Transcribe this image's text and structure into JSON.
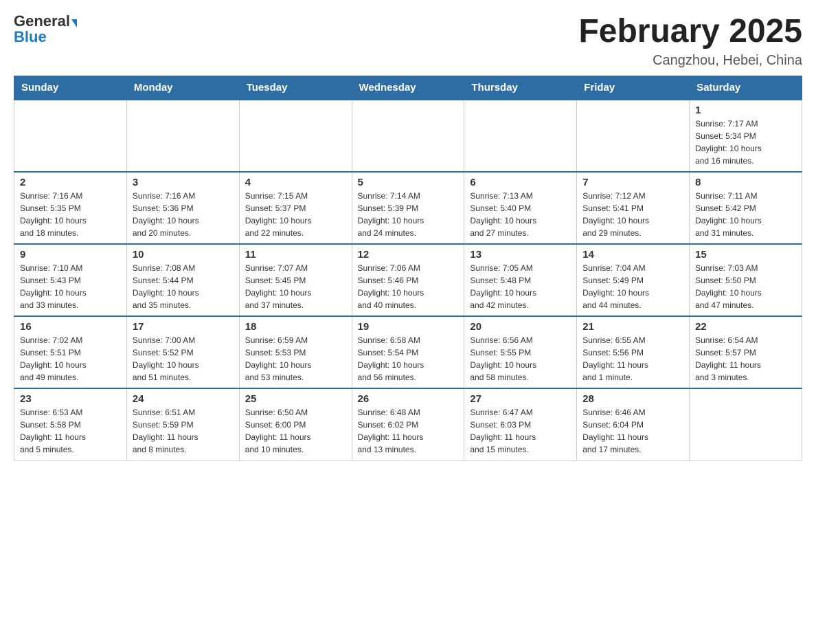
{
  "logo": {
    "general": "General",
    "blue": "Blue"
  },
  "title": "February 2025",
  "subtitle": "Cangzhou, Hebei, China",
  "weekdays": [
    "Sunday",
    "Monday",
    "Tuesday",
    "Wednesday",
    "Thursday",
    "Friday",
    "Saturday"
  ],
  "weeks": [
    [
      {
        "day": "",
        "info": ""
      },
      {
        "day": "",
        "info": ""
      },
      {
        "day": "",
        "info": ""
      },
      {
        "day": "",
        "info": ""
      },
      {
        "day": "",
        "info": ""
      },
      {
        "day": "",
        "info": ""
      },
      {
        "day": "1",
        "info": "Sunrise: 7:17 AM\nSunset: 5:34 PM\nDaylight: 10 hours\nand 16 minutes."
      }
    ],
    [
      {
        "day": "2",
        "info": "Sunrise: 7:16 AM\nSunset: 5:35 PM\nDaylight: 10 hours\nand 18 minutes."
      },
      {
        "day": "3",
        "info": "Sunrise: 7:16 AM\nSunset: 5:36 PM\nDaylight: 10 hours\nand 20 minutes."
      },
      {
        "day": "4",
        "info": "Sunrise: 7:15 AM\nSunset: 5:37 PM\nDaylight: 10 hours\nand 22 minutes."
      },
      {
        "day": "5",
        "info": "Sunrise: 7:14 AM\nSunset: 5:39 PM\nDaylight: 10 hours\nand 24 minutes."
      },
      {
        "day": "6",
        "info": "Sunrise: 7:13 AM\nSunset: 5:40 PM\nDaylight: 10 hours\nand 27 minutes."
      },
      {
        "day": "7",
        "info": "Sunrise: 7:12 AM\nSunset: 5:41 PM\nDaylight: 10 hours\nand 29 minutes."
      },
      {
        "day": "8",
        "info": "Sunrise: 7:11 AM\nSunset: 5:42 PM\nDaylight: 10 hours\nand 31 minutes."
      }
    ],
    [
      {
        "day": "9",
        "info": "Sunrise: 7:10 AM\nSunset: 5:43 PM\nDaylight: 10 hours\nand 33 minutes."
      },
      {
        "day": "10",
        "info": "Sunrise: 7:08 AM\nSunset: 5:44 PM\nDaylight: 10 hours\nand 35 minutes."
      },
      {
        "day": "11",
        "info": "Sunrise: 7:07 AM\nSunset: 5:45 PM\nDaylight: 10 hours\nand 37 minutes."
      },
      {
        "day": "12",
        "info": "Sunrise: 7:06 AM\nSunset: 5:46 PM\nDaylight: 10 hours\nand 40 minutes."
      },
      {
        "day": "13",
        "info": "Sunrise: 7:05 AM\nSunset: 5:48 PM\nDaylight: 10 hours\nand 42 minutes."
      },
      {
        "day": "14",
        "info": "Sunrise: 7:04 AM\nSunset: 5:49 PM\nDaylight: 10 hours\nand 44 minutes."
      },
      {
        "day": "15",
        "info": "Sunrise: 7:03 AM\nSunset: 5:50 PM\nDaylight: 10 hours\nand 47 minutes."
      }
    ],
    [
      {
        "day": "16",
        "info": "Sunrise: 7:02 AM\nSunset: 5:51 PM\nDaylight: 10 hours\nand 49 minutes."
      },
      {
        "day": "17",
        "info": "Sunrise: 7:00 AM\nSunset: 5:52 PM\nDaylight: 10 hours\nand 51 minutes."
      },
      {
        "day": "18",
        "info": "Sunrise: 6:59 AM\nSunset: 5:53 PM\nDaylight: 10 hours\nand 53 minutes."
      },
      {
        "day": "19",
        "info": "Sunrise: 6:58 AM\nSunset: 5:54 PM\nDaylight: 10 hours\nand 56 minutes."
      },
      {
        "day": "20",
        "info": "Sunrise: 6:56 AM\nSunset: 5:55 PM\nDaylight: 10 hours\nand 58 minutes."
      },
      {
        "day": "21",
        "info": "Sunrise: 6:55 AM\nSunset: 5:56 PM\nDaylight: 11 hours\nand 1 minute."
      },
      {
        "day": "22",
        "info": "Sunrise: 6:54 AM\nSunset: 5:57 PM\nDaylight: 11 hours\nand 3 minutes."
      }
    ],
    [
      {
        "day": "23",
        "info": "Sunrise: 6:53 AM\nSunset: 5:58 PM\nDaylight: 11 hours\nand 5 minutes."
      },
      {
        "day": "24",
        "info": "Sunrise: 6:51 AM\nSunset: 5:59 PM\nDaylight: 11 hours\nand 8 minutes."
      },
      {
        "day": "25",
        "info": "Sunrise: 6:50 AM\nSunset: 6:00 PM\nDaylight: 11 hours\nand 10 minutes."
      },
      {
        "day": "26",
        "info": "Sunrise: 6:48 AM\nSunset: 6:02 PM\nDaylight: 11 hours\nand 13 minutes."
      },
      {
        "day": "27",
        "info": "Sunrise: 6:47 AM\nSunset: 6:03 PM\nDaylight: 11 hours\nand 15 minutes."
      },
      {
        "day": "28",
        "info": "Sunrise: 6:46 AM\nSunset: 6:04 PM\nDaylight: 11 hours\nand 17 minutes."
      },
      {
        "day": "",
        "info": ""
      }
    ]
  ]
}
